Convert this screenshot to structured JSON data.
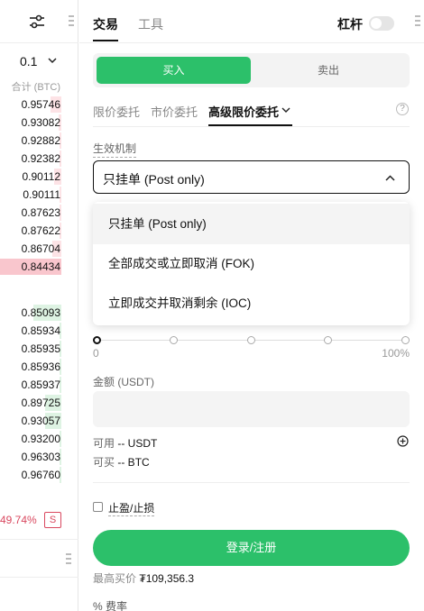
{
  "orderbook": {
    "step_value": "0.1",
    "total_header": "合计 (BTC)",
    "asks": [
      "0.95746",
      "0.93082",
      "0.92882",
      "0.92382",
      "0.90112",
      "0.90111",
      "0.87623",
      "0.87622",
      "0.86704",
      "0.84434"
    ],
    "bids": [
      "0.85093",
      "0.85934",
      "0.85935",
      "0.85936",
      "0.85937",
      "0.89725",
      "0.93057",
      "0.93200",
      "0.96303",
      "0.96760"
    ],
    "ratio": "49.74%",
    "sell_badge": "S"
  },
  "panel": {
    "tab_trade": "交易",
    "tab_tools": "工具",
    "leverage_label": "杠杆",
    "buy_label": "买入",
    "sell_label": "卖出",
    "order_tabs": [
      "限价委托",
      "市价委托",
      "高级限价委托"
    ],
    "help_glyph": "?",
    "mechanism_label": "生效机制",
    "mechanism_value": "只挂单 (Post only)",
    "mechanism_options": [
      "只挂单 (Post only)",
      "全部成交或立即取消 (FOK)",
      "立即成交并取消剩余 (IOC)"
    ],
    "slider_min": "0",
    "slider_max": "100%",
    "amount_label": "金额 (USDT)",
    "available_label": "可用",
    "available_value": "-- USDT",
    "buyable_label": "可买",
    "buyable_value": "-- BTC",
    "tpsl_label": "止盈/止损",
    "login_label": "登录/注册",
    "max_price_label": "最高买价",
    "max_price_value": "₮109,356.3",
    "fee_label": "% 费率"
  },
  "colors": {
    "accent_green": "#2cc06a",
    "ask_red": "#d9485f",
    "ask_bg": "#fde3e6",
    "bid_bg": "#def3e3"
  },
  "orderbook_depth": {
    "asks": [
      0.18,
      0.04,
      0.03,
      0.02,
      0.12,
      0.03,
      0.02,
      0.02,
      0.14,
      1.0
    ],
    "bids": [
      0.45,
      0.02,
      0.02,
      0.02,
      0.02,
      0.26,
      0.26,
      0.02,
      0.02,
      0.02
    ]
  }
}
